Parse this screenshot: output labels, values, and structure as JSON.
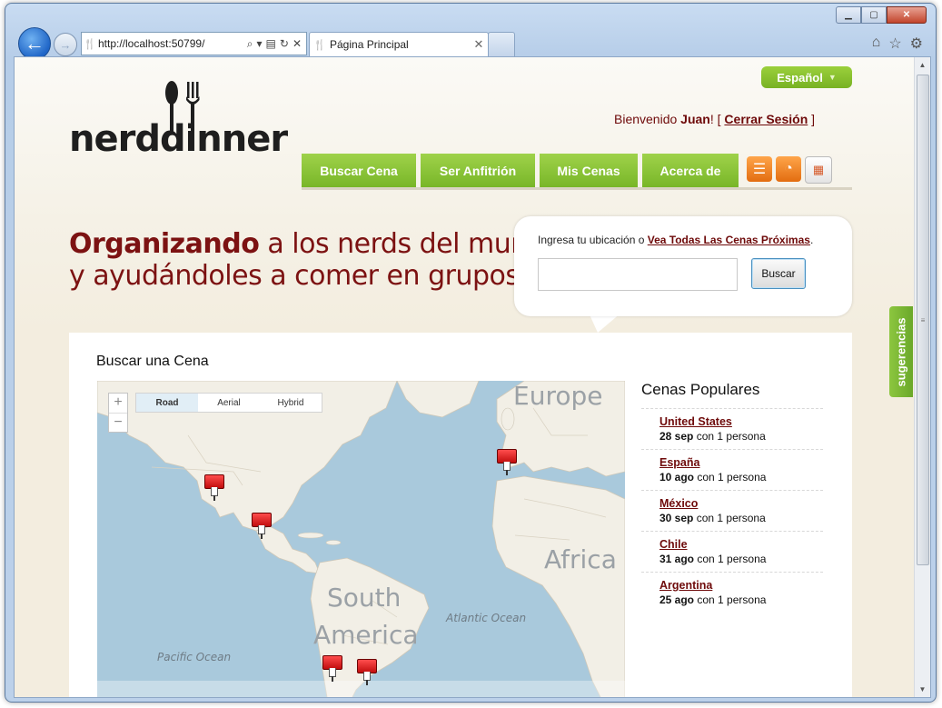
{
  "browser": {
    "address": "http://localhost:50799/",
    "tab_title": "Página Principal"
  },
  "header": {
    "language": "Español",
    "logo_text": "nerddinner",
    "welcome_prefix": "Bienvenido ",
    "user": "Juan",
    "welcome_bracket_open": "! [ ",
    "logout": "Cerrar Sesión",
    "welcome_bracket_close": " ]"
  },
  "nav": {
    "items": [
      {
        "label": "Buscar Cena"
      },
      {
        "label": "Ser Anfitrión"
      },
      {
        "label": "Mis Cenas"
      },
      {
        "label": "Acerca de"
      }
    ]
  },
  "hero": {
    "tag_bold": "Organizando",
    "tag_rest": " a los nerds del mundo",
    "tag_line2": "y ayudándoles a comer en grupos."
  },
  "search": {
    "prompt": "Ingresa tu ubicación o ",
    "link": "Vea Todas Las Cenas Próximas",
    "prompt_end": ".",
    "input_value": "",
    "button": "Buscar"
  },
  "main": {
    "title": "Buscar una Cena",
    "map": {
      "zoom_in": "+",
      "zoom_out": "−",
      "types": [
        "Road",
        "Aerial",
        "Hybrid"
      ],
      "active_type": "Road",
      "labels": {
        "europe": "Europe",
        "africa": "Africa",
        "south": "South",
        "america": "America",
        "atlantic": "Atlantic Ocean",
        "pacific": "Pacific Ocean"
      }
    },
    "popular": {
      "title": "Cenas Populares",
      "items": [
        {
          "country": "United States",
          "date": "28 sep",
          "with": " con ",
          "count": "1",
          "unit": " persona"
        },
        {
          "country": "España",
          "date": "10 ago",
          "with": " con ",
          "count": "1",
          "unit": " persona"
        },
        {
          "country": "México",
          "date": "30 sep",
          "with": " con ",
          "count": "1",
          "unit": " persona"
        },
        {
          "country": "Chile",
          "date": "31 ago",
          "with": " con ",
          "count": "1",
          "unit": " persona"
        },
        {
          "country": "Argentina",
          "date": "25 ago",
          "with": " con ",
          "count": "1",
          "unit": " persona"
        }
      ]
    }
  },
  "feedback": "sugerencias",
  "colors": {
    "brand_red": "#7c1212",
    "brand_green": "#8cc63f",
    "link": "#6e0a0a",
    "map_water": "#a9c9dc",
    "map_land": "#f2efe6"
  },
  "icons": [
    "back-arrow-icon",
    "forward-arrow-icon",
    "restaurant-favicon",
    "search-icon",
    "refresh-icon",
    "home-icon",
    "star-icon",
    "gear-icon",
    "feed-list-icon",
    "rss-icon",
    "calendar-icon",
    "map-pin-icon"
  ]
}
